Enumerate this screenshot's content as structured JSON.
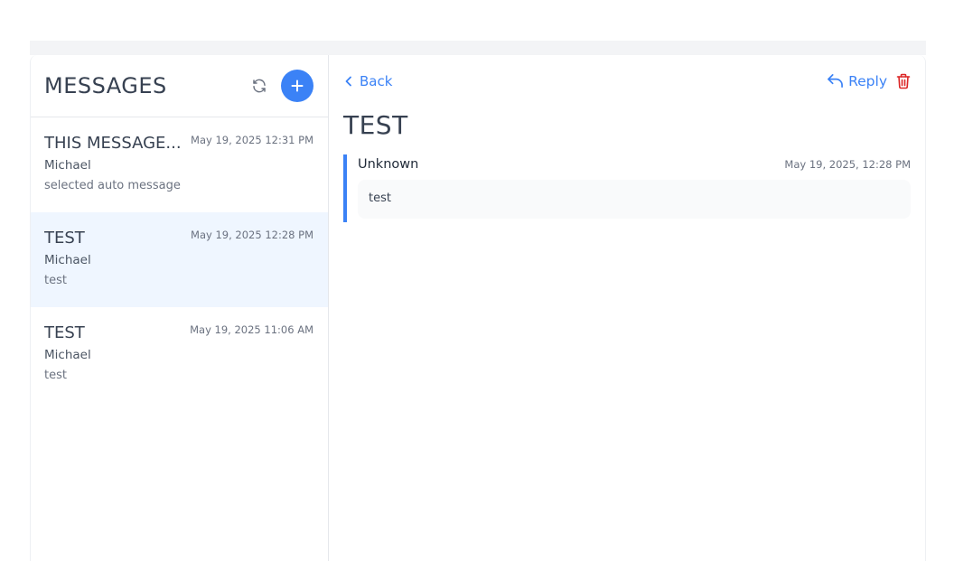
{
  "sidebar": {
    "title": "MESSAGES",
    "items": [
      {
        "subject": "THIS MESSAGE...",
        "date": "May 19, 2025 12:31 PM",
        "sender": "Michael",
        "preview": "selected auto message"
      },
      {
        "subject": "TEST",
        "date": "May 19, 2025 12:28 PM",
        "sender": "Michael",
        "preview": "test"
      },
      {
        "subject": "TEST",
        "date": "May 19, 2025 11:06 AM",
        "sender": "Michael",
        "preview": "test"
      }
    ]
  },
  "detail": {
    "back_label": "Back",
    "reply_label": "Reply",
    "title": "TEST",
    "message": {
      "from": "Unknown",
      "date": "May 19, 2025, 12:28 PM",
      "body": "test"
    }
  },
  "colors": {
    "accent": "#3b82f6",
    "danger": "#dc2626",
    "selected_bg": "#eff6ff"
  },
  "icons": {
    "refresh": "refresh-icon",
    "new": "plus-icon",
    "back": "chevron-left-icon",
    "reply": "reply-icon",
    "delete": "trash-icon"
  }
}
